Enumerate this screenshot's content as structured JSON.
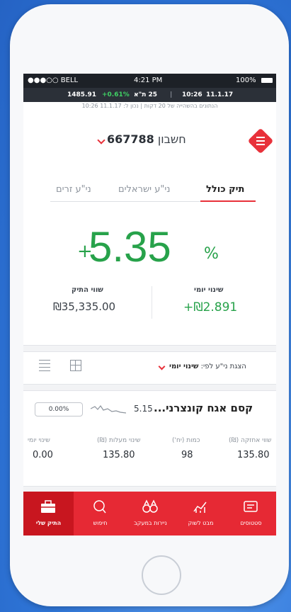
{
  "status_bar": {
    "carrier": "●●●○○ BELL ",
    "time": "4:21 PM",
    "battery": "100%"
  },
  "ticker": {
    "index_value": "1485.91",
    "index_change": "+0.61%",
    "index_name": "25 ת\"א",
    "time": "10:26",
    "date": "11.1.17"
  },
  "delay_note": "הנתונים בהשהייה של 20 דקות | נכון ל: 11.1.17 10:26",
  "account": {
    "label": "חשבון",
    "number": "667788"
  },
  "tabs": [
    {
      "label": "תיק כולל"
    },
    {
      "label": "ני\"ע ישראלים"
    },
    {
      "label": "ני\"ע זרים"
    }
  ],
  "summary": {
    "total_change_plus": "+",
    "total_change_value": "5.35",
    "total_change_unit": "%",
    "daily_change_title": "שינוי יומי",
    "daily_change_value": "+₪2.891",
    "portfolio_value_title": "שווי התיק",
    "portfolio_value": "₪35,335.00"
  },
  "sortbar": {
    "prefix": "הצגת ני\"ע לפי:",
    "selected": "שינוי יומי"
  },
  "stock": {
    "name": "קסם אגח קונצרני...",
    "price": "5.15",
    "change_pill": "0.00%",
    "columns": [
      {
        "header": "שווי אחזקה (₪)",
        "value": "135.80"
      },
      {
        "header": "כמות (יח')",
        "value": "98"
      },
      {
        "header": "שינוי מעלות (₪)",
        "value": "135.80"
      },
      {
        "header": "שינוי יומי",
        "value": "0.00"
      }
    ]
  },
  "bottom_nav": [
    {
      "label": "סטטוסים",
      "icon": "status-icon"
    },
    {
      "label": "מבט לשוק",
      "icon": "market-chart-icon"
    },
    {
      "label": "ניירות במעקב",
      "icon": "binoculars-icon"
    },
    {
      "label": "חיפוש",
      "icon": "search-icon"
    },
    {
      "label": "התיק שלי",
      "icon": "briefcase-icon"
    }
  ],
  "colors": {
    "accent": "#e8313a",
    "positive": "#27a24a",
    "nav_bg": "#e62934",
    "nav_active": "#c8161f"
  }
}
